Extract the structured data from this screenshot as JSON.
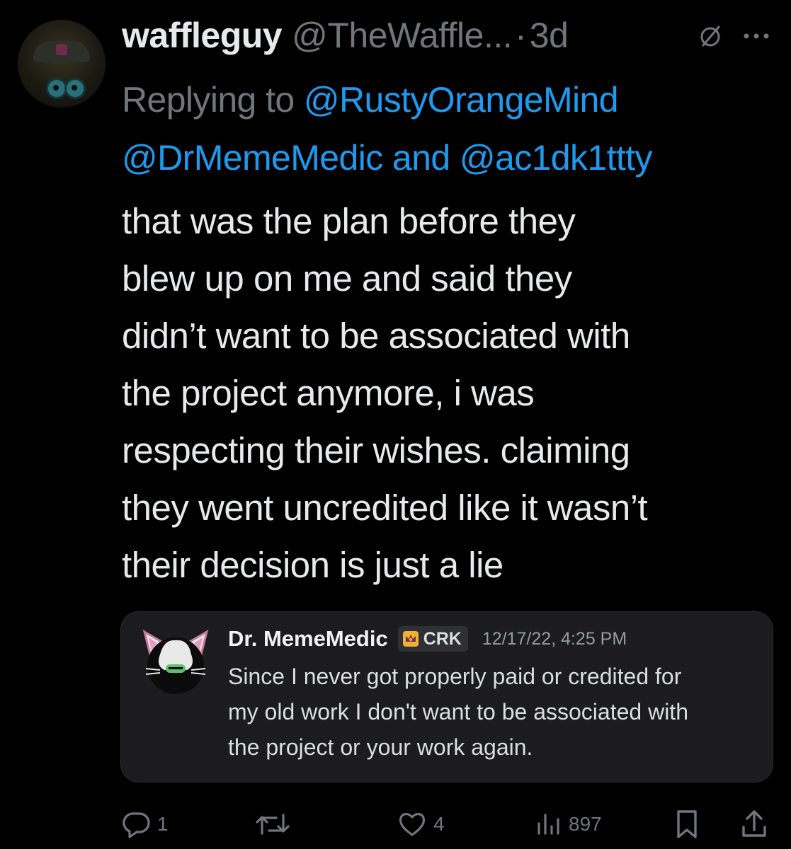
{
  "tweet": {
    "display_name": "waffleguy",
    "handle": "@TheWaffle...",
    "separator": "·",
    "time": "3d",
    "replying_prefix": "Replying to",
    "reply_handles": [
      "@RustyOrangeMind",
      "@DrMemeMedic",
      "@ac1dk1ttty"
    ],
    "reply_joiner": "and",
    "text_lines": [
      "that was the plan before they",
      "blew up on me and said they",
      "didn’t want to be associated with",
      "the project anymore, i was",
      "respecting their wishes. claiming",
      "they went uncredited like it wasn’t",
      "their decision is just a lie"
    ]
  },
  "icons": {
    "grok": "slashed-circle-icon",
    "more": "more-dots-icon",
    "reply": "reply-bubble-icon",
    "repost": "repost-icon",
    "like": "heart-icon",
    "views": "views-bars-icon",
    "bookmark": "bookmark-icon",
    "share": "share-icon"
  },
  "embedded_message": {
    "author": "Dr. MemeMedic",
    "tag_label": "CRK",
    "timestamp": "12/17/22, 4:25 PM",
    "text_lines": [
      "Since I never got properly paid or credited for",
      "my old work I don't want to be associated with",
      "the project or your work again."
    ]
  },
  "actions": {
    "replies": "1",
    "reposts": "",
    "likes": "4",
    "views": "897"
  },
  "colors": {
    "background": "#000000",
    "text": "#e7e9ea",
    "muted": "#71767b",
    "link": "#1d9bf0",
    "card_background": "#1c1c1e"
  }
}
